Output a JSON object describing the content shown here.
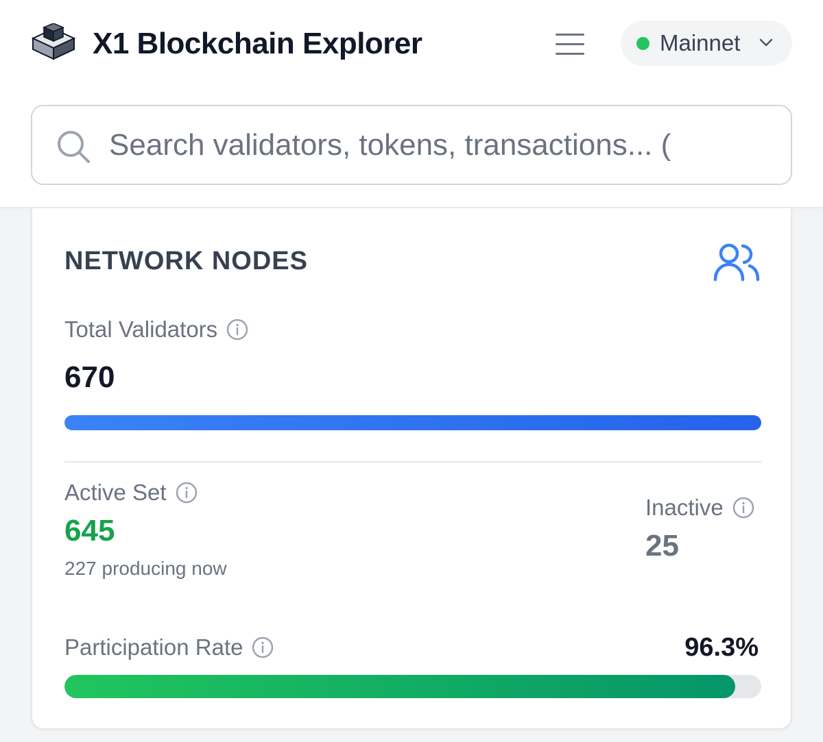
{
  "header": {
    "app_title": "X1 Blockchain Explorer",
    "network": {
      "label": "Mainnet",
      "status_color": "#22c55e"
    }
  },
  "search": {
    "placeholder": "Search validators, tokens, transactions... (",
    "value": ""
  },
  "network_nodes": {
    "title": "NETWORK NODES",
    "total_validators": {
      "label": "Total Validators",
      "value": "670",
      "bar_fraction": 1.0
    },
    "active_set": {
      "label": "Active Set",
      "value": "645",
      "sub_text": "227 producing now"
    },
    "inactive": {
      "label": "Inactive",
      "value": "25"
    },
    "participation_rate": {
      "label": "Participation Rate",
      "value": "96.3%",
      "fraction": 0.963
    }
  },
  "colors": {
    "accent_blue": "#3b82f6",
    "success_green": "#16a34a"
  },
  "icons": {
    "logo": "cube-logo",
    "menu": "hamburger-menu-icon",
    "dropdown": "chevron-down-icon",
    "search": "search-icon",
    "users": "users-icon",
    "info": "info-icon"
  }
}
